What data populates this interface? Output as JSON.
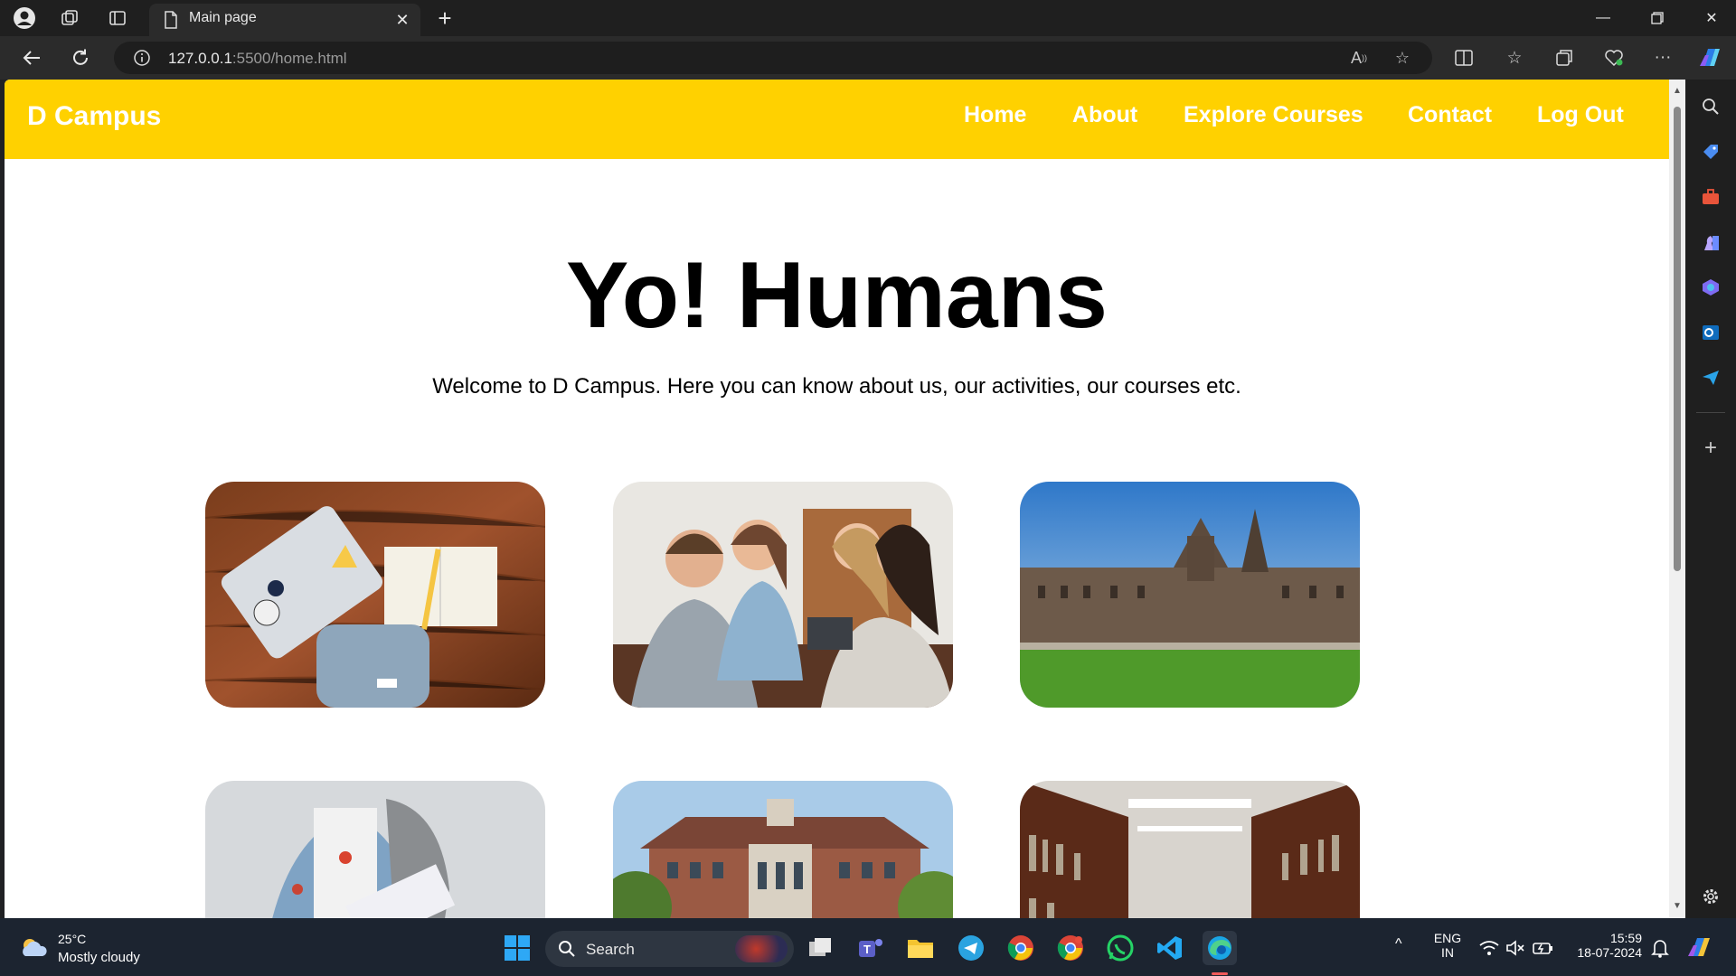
{
  "browser": {
    "tab_title": "Main page",
    "url_host": "127.0.0.1",
    "url_rest": ":5500/home.html"
  },
  "site": {
    "brand": "D Campus",
    "nav": [
      "Home",
      "About",
      "Explore Courses",
      "Contact",
      "Log Out"
    ],
    "hero_title": "Yo! Humans",
    "hero_subtitle": "Welcome to D Campus. Here you can know about us, our activities, our courses etc."
  },
  "colors": {
    "nav_bg": "#ffd100",
    "nav_text": "#ffffff"
  },
  "taskbar": {
    "weather_temp": "25°C",
    "weather_desc": "Mostly cloudy",
    "search_label": "Search",
    "lang_line1": "ENG",
    "lang_line2": "IN",
    "time": "15:59",
    "date": "18-07-2024"
  }
}
